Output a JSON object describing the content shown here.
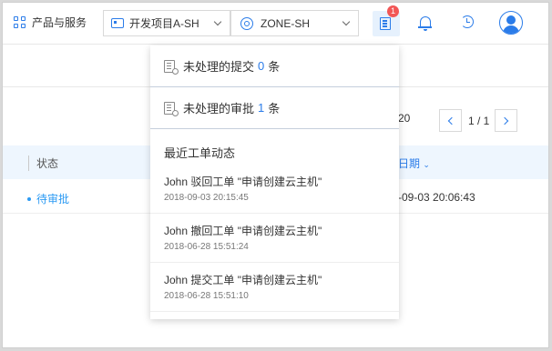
{
  "header": {
    "products_label": "产品与服务",
    "project_label": "开发项目A-SH",
    "zone_label": "ZONE-SH",
    "ticket_badge": "1",
    "icons": [
      "grid-icon",
      "project-icon",
      "zone-icon",
      "ticket-icon",
      "bell-icon",
      "history-icon",
      "avatar-icon"
    ],
    "accent_color": "#2b7ce9",
    "badge_color": "#f25656"
  },
  "table": {
    "page_size": "20",
    "page_info": "1 / 1",
    "columns": {
      "status": "状态",
      "date": "日期"
    },
    "rows": [
      {
        "status": "待审批",
        "date": "-09-03 20:06:43"
      }
    ]
  },
  "panel": {
    "summaries": [
      {
        "prefix": "未处理的提交",
        "count": "0",
        "suffix": "条"
      },
      {
        "prefix": "未处理的审批",
        "count": "1",
        "suffix": "条"
      }
    ],
    "recent_title": "最近工单动态",
    "activities": [
      {
        "text": "John 驳回工单 \"申请创建云主机\"",
        "time": "2018-09-03 20:15:45"
      },
      {
        "text": "John 撤回工单 \"申请创建云主机\"",
        "time": "2018-06-28 15:51:24"
      },
      {
        "text": "John 提交工单 \"申请创建云主机\"",
        "time": "2018-06-28 15:51:10"
      }
    ]
  }
}
